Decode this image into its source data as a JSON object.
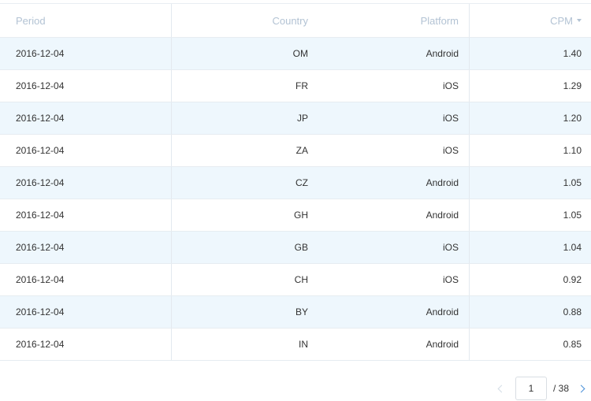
{
  "table": {
    "columns": {
      "period": "Period",
      "country": "Country",
      "platform": "Platform",
      "cpm": "CPM"
    },
    "rows": [
      {
        "period": "2016-12-04",
        "country": "OM",
        "platform": "Android",
        "cpm": "1.40"
      },
      {
        "period": "2016-12-04",
        "country": "FR",
        "platform": "iOS",
        "cpm": "1.29"
      },
      {
        "period": "2016-12-04",
        "country": "JP",
        "platform": "iOS",
        "cpm": "1.20"
      },
      {
        "period": "2016-12-04",
        "country": "ZA",
        "platform": "iOS",
        "cpm": "1.10"
      },
      {
        "period": "2016-12-04",
        "country": "CZ",
        "platform": "Android",
        "cpm": "1.05"
      },
      {
        "period": "2016-12-04",
        "country": "GH",
        "platform": "Android",
        "cpm": "1.05"
      },
      {
        "period": "2016-12-04",
        "country": "GB",
        "platform": "iOS",
        "cpm": "1.04"
      },
      {
        "period": "2016-12-04",
        "country": "CH",
        "platform": "iOS",
        "cpm": "0.92"
      },
      {
        "period": "2016-12-04",
        "country": "BY",
        "platform": "Android",
        "cpm": "0.88"
      },
      {
        "period": "2016-12-04",
        "country": "IN",
        "platform": "Android",
        "cpm": "0.85"
      }
    ]
  },
  "pagination": {
    "current_page": "1",
    "total_label": "/ 38"
  },
  "colors": {
    "stripe": "#eef7fd",
    "header_text": "#b3c3d4",
    "accent": "#4a90d9"
  },
  "icons": {
    "sort": "caret-down-icon",
    "prev": "chevron-left-icon",
    "next": "chevron-right-icon"
  }
}
